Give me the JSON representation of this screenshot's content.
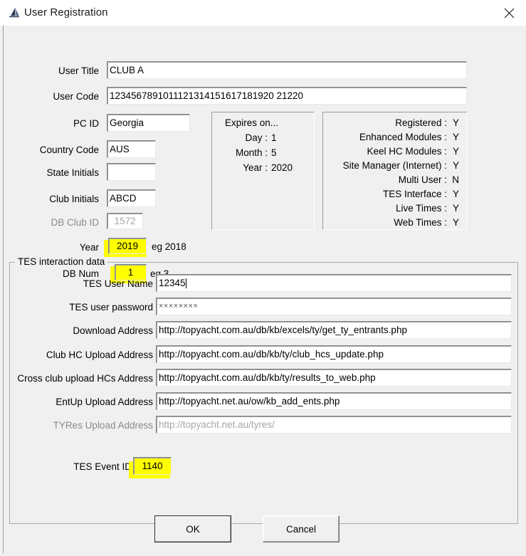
{
  "window": {
    "title": "User Registration",
    "icon": "sailboat-icon",
    "close_label": "✕"
  },
  "form": {
    "rows": [
      {
        "label": "User Title",
        "value": "CLUB A"
      },
      {
        "label": "User Code",
        "value": "1234567891011121314151617181920 21220"
      },
      {
        "label": "PC ID",
        "value": "Georgia"
      },
      {
        "label": "Country Code",
        "value": "AUS"
      },
      {
        "label": "State Initials",
        "value": ""
      },
      {
        "label": "Club Initials",
        "value": "ABCD"
      },
      {
        "label": "DB Club ID",
        "value": "1572"
      },
      {
        "label": "Year",
        "value": "2019",
        "hint": "eg 2018"
      },
      {
        "label": "DB Num",
        "value": "1",
        "hint": "eg 3"
      }
    ]
  },
  "expires_panel": {
    "title": "Expires on...",
    "lines": [
      {
        "label": "Day :",
        "value": "1"
      },
      {
        "label": "Month :",
        "value": "5"
      },
      {
        "label": "Year :",
        "value": "2020"
      }
    ]
  },
  "status_panel": {
    "lines": [
      {
        "label": "Registered :",
        "value": "Y"
      },
      {
        "label": "Enhanced Modules :",
        "value": "Y"
      },
      {
        "label": "Keel HC Modules :",
        "value": "Y"
      },
      {
        "label": "Site Manager (Internet) :",
        "value": "Y"
      },
      {
        "label": "Multi User :",
        "value": "N"
      },
      {
        "label": "TES Interface :",
        "value": "Y"
      },
      {
        "label": "Live Times :",
        "value": "Y"
      },
      {
        "label": "Web Times :",
        "value": "Y"
      }
    ]
  },
  "tes_group": {
    "caption": "TES interaction data",
    "rows": [
      {
        "label": "TES User Name",
        "value": "12345"
      },
      {
        "label": "TES user password",
        "value": "××××××××"
      },
      {
        "label": "Download Address",
        "value": "http://topyacht.com.au/db/kb/excels/ty/get_ty_entrants.php"
      },
      {
        "label": "Club HC Upload Address",
        "value": "http://topyacht.com.au/db/kb/ty/club_hcs_update.php"
      },
      {
        "label": "Cross club upload HCs Address",
        "value": "http://topyacht.com.au/db/kb/ty/results_to_web.php"
      },
      {
        "label": "EntUp Upload Address",
        "value": "http://topyacht.net.au/ow/kb_add_ents.php"
      },
      {
        "label": "TYRes Upload Address",
        "value": "http://topyacht.net.au/tyres/"
      }
    ],
    "event_id": {
      "label": "TES Event ID",
      "value": "1140"
    }
  },
  "buttons": {
    "ok": "OK",
    "cancel": "Cancel"
  },
  "colors": {
    "highlight": "#ffff00",
    "face": "#f0f0f0",
    "field_bg": "#ffffff",
    "disabled_text": "#a6a6a6"
  }
}
